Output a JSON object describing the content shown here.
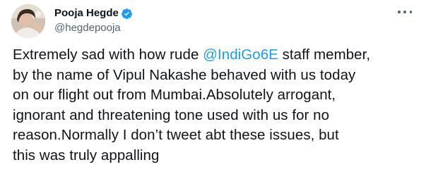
{
  "author": {
    "display_name": "Pooja Hegde",
    "handle": "@hegdepooja",
    "verified": true
  },
  "menu": {
    "icon": "more-horizontal-icon"
  },
  "colors": {
    "text": "#0f1419",
    "secondary": "#536471",
    "link": "#1d9bf0",
    "verified_badge": "#1d9bf0"
  },
  "tweet": {
    "line1_pre": "Extremely sad with how rude ",
    "mention": "@IndiGo6E",
    "line1_post": " staff member,",
    "line2": "by the name of Vipul Nakashe behaved with us today",
    "line3": "on our flight out from Mumbai.Absolutely arrogant,",
    "line4": "ignorant and threatening tone used with us for no",
    "line5": "reason.Normally I don’t tweet abt these issues, but",
    "line6": "this was truly appalling"
  }
}
